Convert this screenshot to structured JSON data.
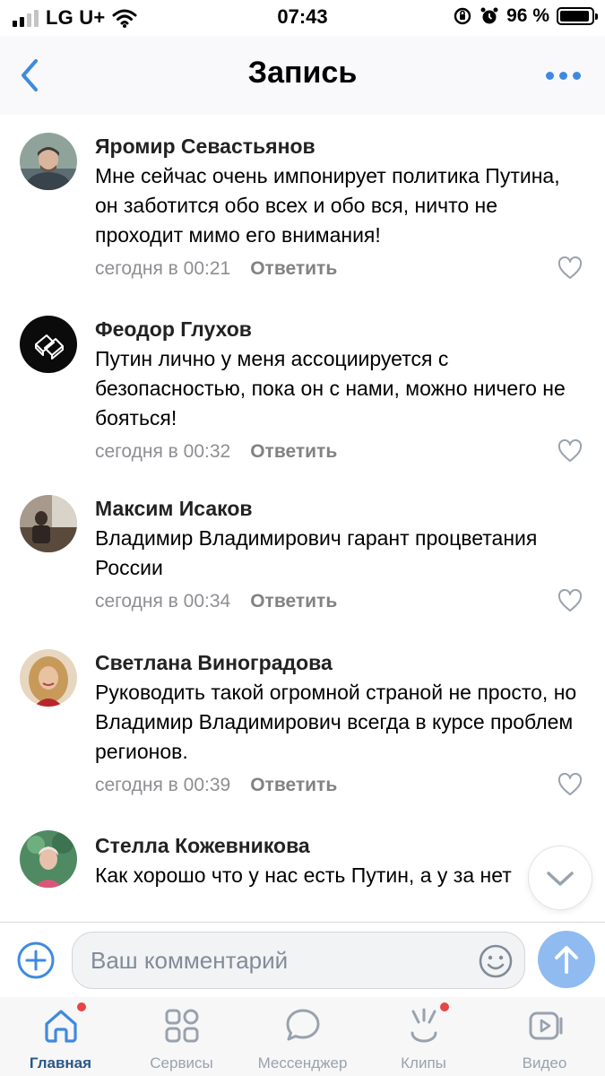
{
  "status_bar": {
    "carrier": "LG U+",
    "time": "07:43",
    "battery_percent": "96 %",
    "battery_level": 0.96,
    "signal_bars_active": 2
  },
  "header": {
    "title": "Запись",
    "back_icon": "chevron-left-icon",
    "more_icon": "more-dots-icon"
  },
  "comments": [
    {
      "author": "Яромир Севастьянов",
      "text": "Мне сейчас очень импонирует политика Путина, он заботится обо всех и обо вся, ничто не проходит мимо его внимания!",
      "time": "сегодня в 00:21",
      "reply_label": "Ответить"
    },
    {
      "author": "Феодор Глухов",
      "text": "Путин лично у меня ассоциируется с безопасностью, пока он с нами, можно ничего не бояться!",
      "time": "сегодня в 00:32",
      "reply_label": "Ответить"
    },
    {
      "author": "Максим Исаков",
      "text": "Владимир Владимирович гарант процветания России",
      "time": "сегодня в 00:34",
      "reply_label": "Ответить"
    },
    {
      "author": "Светлана Виноградова",
      "text": "Руководить такой огромной страной не просто, но Владимир Владимирович всегда в курсе проблем регионов.",
      "time": "сегодня в 00:39",
      "reply_label": "Ответить"
    },
    {
      "author": "Стелла Кожевникова",
      "text": "Как хорошо что у нас есть Путин, а у за нет",
      "time": "",
      "reply_label": ""
    }
  ],
  "composer": {
    "placeholder": "Ваш комментарий",
    "value": ""
  },
  "tabs": [
    {
      "label": "Главная",
      "icon": "home-icon",
      "active": true,
      "badge": true
    },
    {
      "label": "Сервисы",
      "icon": "services-grid-icon",
      "active": false,
      "badge": false
    },
    {
      "label": "Мессенджер",
      "icon": "chat-bubble-icon",
      "active": false,
      "badge": false
    },
    {
      "label": "Клипы",
      "icon": "clips-icon",
      "active": false,
      "badge": true
    },
    {
      "label": "Видео",
      "icon": "video-icon",
      "active": false,
      "badge": false
    }
  ],
  "colors": {
    "accent": "#3f8ae0",
    "tab_active": "#2a5885",
    "tab_inactive": "#99a2ad",
    "meta_text": "#8e8e93",
    "badge": "#e64646",
    "send_button": "#8fbbf0"
  }
}
